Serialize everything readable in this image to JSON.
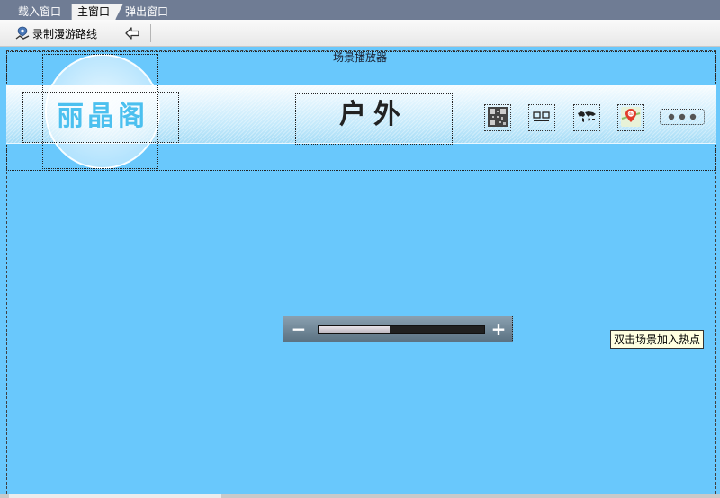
{
  "tabs": [
    {
      "label": "载入窗口",
      "active": false
    },
    {
      "label": "主窗口",
      "active": true
    },
    {
      "label": "弹出窗口",
      "active": false
    }
  ],
  "toolbar": {
    "record_label": "录制漫游路线",
    "back_icon": "arrow-left-icon"
  },
  "stage": {
    "title": "场景播放器",
    "logo_text": "丽晶阁",
    "scene_title": "户外",
    "icons": [
      "qr-code-icon",
      "thumbnails-icon",
      "world-map-icon",
      "baidu-map-icon",
      "more-icon"
    ],
    "zoom": {
      "minus": "−",
      "plus": "+",
      "level": 0.43
    },
    "tooltip": "双击场景加入热点"
  },
  "colors": {
    "stage_bg": "#69c8fc",
    "tabbar_bg": "#6f7c94",
    "logo_text": "#4cc0ef"
  }
}
